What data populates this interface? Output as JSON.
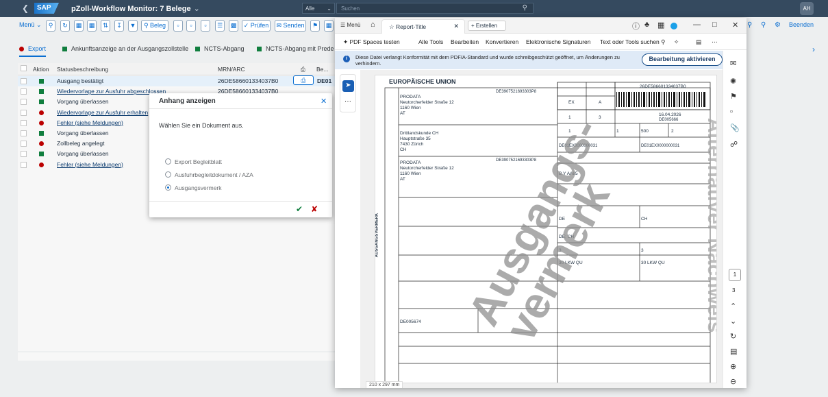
{
  "shell": {
    "logo": "SAP",
    "app_title": "pZoll-Workflow Monitor: 7 Belege",
    "search_scope": "Alle",
    "search_placeholder": "Suchen",
    "user_initials": "AH"
  },
  "toolbar": {
    "menu_label": "Menü",
    "beleg_label": "Beleg",
    "pruefen_label": "Prüfen",
    "senden_label": "Senden",
    "beenden_label": "Beenden"
  },
  "tabs": [
    {
      "label": "Export",
      "color": "#bb0000"
    },
    {
      "label": "Ankunftsanzeige an der Ausgangszollstelle",
      "color": "#107e3e"
    },
    {
      "label": "NCTS-Abgang",
      "color": "#107e3e"
    },
    {
      "label": "NCTS-Abgang mit Predeklaration",
      "color": "#107e3e"
    }
  ],
  "table": {
    "columns": {
      "aktion": "Aktion",
      "status": "Statusbeschreibung",
      "mrn": "MRN/ARC",
      "be": "Be..."
    },
    "rows": [
      {
        "status": "Ausgang bestätigt",
        "mrn": "26DE586601334037B0",
        "icon": "square",
        "link": false,
        "be": "DE01"
      },
      {
        "status": "Wiedervorlage zur Ausfuhr abgeschlossen",
        "mrn": "26DE586601334037B0",
        "icon": "square",
        "link": true,
        "be": ""
      },
      {
        "status": "Vorgang überlassen",
        "mrn": "",
        "icon": "square",
        "link": false,
        "be": ""
      },
      {
        "status": "Wiedervorlage zur Ausfuhr erhalten",
        "mrn": "",
        "icon": "circle",
        "link": true,
        "be": ""
      },
      {
        "status": "Fehler (siehe Meldungen)",
        "mrn": "",
        "icon": "circle",
        "link": true,
        "be": ""
      },
      {
        "status": "Vorgang überlassen",
        "mrn": "",
        "icon": "square",
        "link": false,
        "be": ""
      },
      {
        "status": "Zollbeleg angelegt",
        "mrn": "",
        "icon": "circle",
        "link": false,
        "be": ""
      },
      {
        "status": "Vorgang überlassen",
        "mrn": "",
        "icon": "square",
        "link": false,
        "be": ""
      },
      {
        "status": "Fehler (siehe Meldungen)",
        "mrn": "",
        "icon": "circle",
        "link": true,
        "be": ""
      }
    ]
  },
  "dialog": {
    "title": "Anhang anzeigen",
    "prompt": "Wählen Sie ein Dokument aus.",
    "options": [
      {
        "label": "Export Begleitblatt",
        "selected": false
      },
      {
        "label": "Ausfuhrbegleitdokument / AZA",
        "selected": false
      },
      {
        "label": "Ausgangsvermerk",
        "selected": true
      }
    ]
  },
  "pdf": {
    "menu_label": "Menü",
    "tab_title": "Report-Title",
    "new_tab_label": "Erstellen",
    "tools": [
      "PDF Spaces testen",
      "Alle Tools",
      "Bearbeiten",
      "Konvertieren",
      "Elektronische Signaturen",
      "Text oder Tools suchen"
    ],
    "banner_text": "Diese Datei verlangt Konformität mit dem PDF/A-Standard und wurde schreibgeschützt geöffnet, um Änderungen zu verhindern.",
    "banner_button": "Bearbeitung aktivieren",
    "page_size": "210 x 297 mm",
    "current_page": "1",
    "total_pages": "3"
  },
  "form": {
    "header": "EUROPÄISCHE UNION",
    "side_label": "AUSGANGSVERMERK",
    "watermark_main": "Ausgangs-\nvermerk",
    "watermark_side": "Alternativer Nachweis",
    "exporter_name": "PRODATA",
    "exporter_street": "Neutorcherfelder Straße 12",
    "exporter_city": "1160 Wien",
    "exporter_country": "AT",
    "exporter_eori": "DE3907521693303P8",
    "consignee_name": "Drittlandskunde CH",
    "consignee_street": "Hauptstraße 35",
    "consignee_city": "7430 Zürich",
    "consignee_country": "CH",
    "declarant_name": "PRODATA",
    "declarant_street": "Neutorcherfelder Straße 12",
    "declarant_city": "1160 Wien",
    "declarant_country": "AT",
    "declarant_eori": "DE3907521693303P8",
    "mrn": "26DE586601334037B0",
    "type1": "EX",
    "type2": "A",
    "date": "16.04.2026",
    "office_code": "DE005666",
    "forms": "1",
    "forms_of": "3",
    "positions": "1",
    "packages": "1",
    "gross": "500",
    "ref_count": "2",
    "lrn": "DE01EX0000000031",
    "ref_no": "DE01EX0000000031",
    "transport_id": "B Y AA85",
    "dispatch_country": "DE",
    "destination_country": "CH",
    "dispatch_countries": "DE; CH",
    "mode1": "3",
    "mode2": "3",
    "vehicle1": "30 LKW QU",
    "vehicle2": "30 LKW QU",
    "exit_office": "DE005674"
  }
}
